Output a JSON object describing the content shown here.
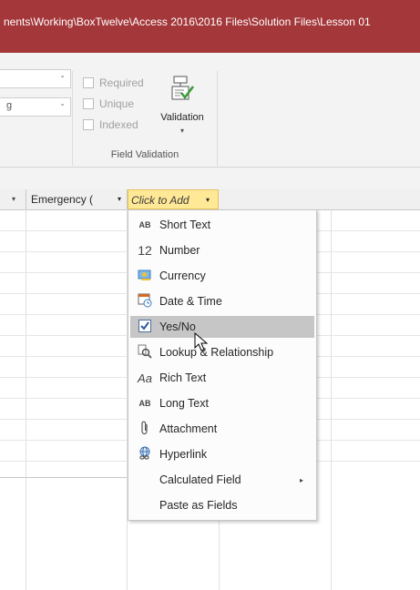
{
  "titlebar": {
    "path": "nents\\Working\\BoxTwelve\\Access 2016\\2016 Files\\Solution Files\\Lesson 01"
  },
  "ribbon": {
    "combo1": {
      "value": "",
      "arrow": "⌄"
    },
    "combo2": {
      "value": "g",
      "arrow": "⌄"
    },
    "checkboxes": {
      "required": "Required",
      "unique": "Unique",
      "indexed": "Indexed"
    },
    "validation_button": {
      "label": "Validation",
      "arrow": "▾",
      "icon": "validation-icon"
    },
    "group_label": "Field Validation"
  },
  "datasheet": {
    "col1_arrow": "▾",
    "col2_label": "Emergency (",
    "col2_arrow": "▾",
    "col3_label": "Click to Add",
    "col3_arrow": "▾"
  },
  "menu": {
    "items": [
      {
        "icon": "AB",
        "label": "Short Text",
        "icon_name": "short-text-icon"
      },
      {
        "icon": "12",
        "label": "Number",
        "icon_name": "number-icon"
      },
      {
        "icon": "",
        "label": "Currency",
        "icon_name": "currency-icon"
      },
      {
        "icon": "",
        "label": "Date & Time",
        "icon_name": "date-time-icon"
      },
      {
        "icon": "",
        "label": "Yes/No",
        "icon_name": "checkbox-icon",
        "highlighted": true
      },
      {
        "icon": "",
        "label": "Lookup & Relationship",
        "icon_name": "lookup-icon"
      },
      {
        "icon": "Aa",
        "label": "Rich Text",
        "icon_name": "rich-text-icon"
      },
      {
        "icon": "AB",
        "label": "Long Text",
        "icon_name": "long-text-icon"
      },
      {
        "icon": "",
        "label": "Attachment",
        "icon_name": "paperclip-icon"
      },
      {
        "icon": "",
        "label": "Hyperlink",
        "icon_name": "hyperlink-icon"
      },
      {
        "icon": "",
        "label": "Calculated Field",
        "icon_name": "none",
        "submenu_arrow": "▸"
      },
      {
        "icon": "",
        "label": "Paste as Fields",
        "icon_name": "none"
      }
    ]
  },
  "colors": {
    "titlebar": "#a4373a",
    "header_highlight": "#ffe896",
    "menu_highlight": "#c6c6c6"
  }
}
